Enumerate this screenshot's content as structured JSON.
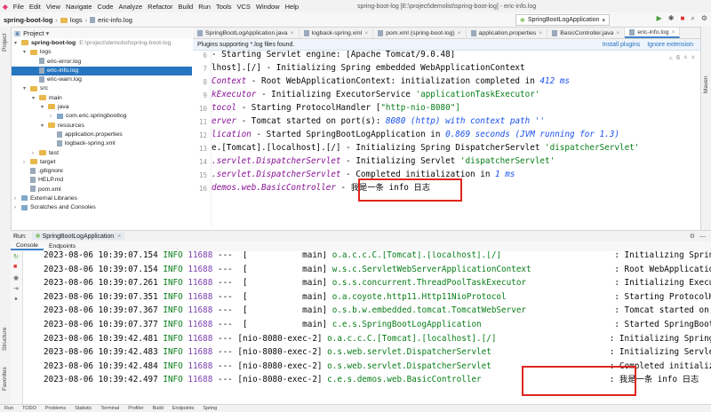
{
  "menu": {
    "items": [
      "File",
      "Edit",
      "View",
      "Navigate",
      "Code",
      "Analyze",
      "Refactor",
      "Build",
      "Run",
      "Tools",
      "VCS",
      "Window",
      "Help"
    ],
    "window_title": "spring-boot-log [E:\\project\\demolist\\spring-boot-log] - eric-info.log"
  },
  "breadcrumb": [
    "spring-boot-log",
    "logs",
    "eric-info.log"
  ],
  "run_config": "SpringBootLogApplication",
  "project": {
    "header": "Project",
    "tree": [
      {
        "label": "spring-boot-log",
        "suffix": "E:\\project\\demolist\\spring-boot-log",
        "indent": 0,
        "type": "folder",
        "open": true
      },
      {
        "label": "logs",
        "indent": 1,
        "type": "folder",
        "open": true
      },
      {
        "label": "eric-error.log",
        "indent": 2,
        "type": "file"
      },
      {
        "label": "eric-info.log",
        "indent": 2,
        "type": "file",
        "selected": true
      },
      {
        "label": "eric-warn.log",
        "indent": 2,
        "type": "file"
      },
      {
        "label": "src",
        "indent": 1,
        "type": "folder",
        "open": true
      },
      {
        "label": "main",
        "indent": 2,
        "type": "folder",
        "open": true
      },
      {
        "label": "java",
        "indent": 3,
        "type": "folder",
        "open": true
      },
      {
        "label": "com.eric.springbootlog",
        "indent": 4,
        "type": "pkg",
        "closed": true
      },
      {
        "label": "resources",
        "indent": 3,
        "type": "folder",
        "open": true
      },
      {
        "label": "application.properties",
        "indent": 4,
        "type": "file"
      },
      {
        "label": "logback-spring.xml",
        "indent": 4,
        "type": "file"
      },
      {
        "label": "test",
        "indent": 2,
        "type": "folder",
        "closed": true
      },
      {
        "label": "target",
        "indent": 1,
        "type": "folder",
        "closed": true
      },
      {
        "label": ".gitignore",
        "indent": 1,
        "type": "file"
      },
      {
        "label": "HELP.md",
        "indent": 1,
        "type": "file"
      },
      {
        "label": "pom.xml",
        "indent": 1,
        "type": "file"
      },
      {
        "label": "External Libraries",
        "indent": 0,
        "type": "pkg",
        "closed": true
      },
      {
        "label": "Scratches and Consoles",
        "indent": 0,
        "type": "pkg",
        "closed": true
      }
    ]
  },
  "tabs": [
    {
      "label": "SpringBootLogApplication.java"
    },
    {
      "label": "logback-spring.xml"
    },
    {
      "label": "pom.xml (spring-boot-log)"
    },
    {
      "label": "application.properties"
    },
    {
      "label": "BasicController.java"
    },
    {
      "label": "eric-info.log",
      "active": true
    }
  ],
  "notice": {
    "message": "Plugins supporting *.log files found.",
    "install": "Install plugins",
    "ignore": "Ignore extension"
  },
  "editor": {
    "gutter": [
      "6",
      "7",
      "8",
      "9",
      "10",
      "11",
      "12",
      "13",
      "14",
      "15",
      "16"
    ],
    "lines": [
      {
        "a": "- Starting Servlet engine: [Apache Tomcat/9.0.48]",
        "b": "",
        "c": ""
      },
      {
        "a": "lhost].[/] - Initializing Spring embedded WebApplicationContext",
        "b": "",
        "c": ""
      },
      {
        "a": "Context",
        "b": " - Root WebApplicationContext: initialization completed in ",
        "c": "412 ms"
      },
      {
        "a": "kExecutor",
        "b": " - Initializing ExecutorService ",
        "c": "'applicationTaskExecutor'"
      },
      {
        "a": "tocol",
        "b": " - Starting ProtocolHandler [",
        "c": "\"http-nio-8080\"]"
      },
      {
        "a": "erver",
        "b": " - Tomcat started on port(s): ",
        "c": "8080 (http) with context path ''"
      },
      {
        "a": "lication",
        "b": " - Started SpringBootLogApplication in ",
        "c": "0.869 seconds (JVM running for 1.3)"
      },
      {
        "a": "e.[Tomcat].[localhost].[/] - Initializing Spring DispatcherServlet ",
        "b": "",
        "c": "'dispatcherServlet'"
      },
      {
        "a": ".servlet.DispatcherServlet",
        "b": " - Initializing Servlet ",
        "c": "'dispatcherServlet'"
      },
      {
        "a": ".servlet.DispatcherServlet",
        "b": " - Completed initialization in ",
        "c": "1 ms"
      },
      {
        "a": "demos.web.BasicController",
        "b": " - 我是一条 info 日志",
        "c": ""
      }
    ]
  },
  "run_panel": {
    "label": "Run:",
    "config": "SpringBootLogApplication",
    "tabs": [
      "Console",
      "Endpoints"
    ]
  },
  "console": [
    {
      "t": "2023-08-06 10:39:07.154",
      "lv": "INFO",
      "pid": "11688",
      "th": "---  [           main]",
      "lg": "o.a.c.c.C.[Tomcat].[localhost].[/]",
      "msg": ": Initializing Spring embedded WebApplic"
    },
    {
      "t": "2023-08-06 10:39:07.154",
      "lv": "INFO",
      "pid": "11688",
      "th": "---  [           main]",
      "lg": "w.s.c.ServletWebServerApplicationContext",
      "msg": ": Root WebApplicationContext: initiali"
    },
    {
      "t": "2023-08-06 10:39:07.261",
      "lv": "INFO",
      "pid": "11688",
      "th": "---  [           main]",
      "lg": "o.s.s.concurrent.ThreadPoolTaskExecutor",
      "msg": ": Initializing ExecutorService 'applic"
    },
    {
      "t": "2023-08-06 10:39:07.351",
      "lv": "INFO",
      "pid": "11688",
      "th": "---  [           main]",
      "lg": "o.a.coyote.http11.Http11NioProtocol",
      "msg": ": Starting ProtocolHandler [\"http-nio"
    },
    {
      "t": "2023-08-06 10:39:07.367",
      "lv": "INFO",
      "pid": "11688",
      "th": "---  [           main]",
      "lg": "o.s.b.w.embedded.tomcat.TomcatWebServer",
      "msg": ": Tomcat started on port(s): 8080 (htt"
    },
    {
      "t": "2023-08-06 10:39:07.377",
      "lv": "INFO",
      "pid": "11688",
      "th": "---  [           main]",
      "lg": "c.e.s.SpringBootLogApplication",
      "msg": ": Started SpringBootLogApplication in"
    },
    {
      "t": "2023-08-06 10:39:42.481",
      "lv": "INFO",
      "pid": "11688",
      "th": "--- [nio-8080-exec-2]",
      "lg": "o.a.c.c.C.[Tomcat].[localhost].[/]",
      "msg": ": Initializing Spring DispatcherServle"
    },
    {
      "t": "2023-08-06 10:39:42.483",
      "lv": "INFO",
      "pid": "11688",
      "th": "--- [nio-8080-exec-2]",
      "lg": "o.s.web.servlet.DispatcherServlet",
      "msg": ": Initializing Servlet 'dispatcherServ"
    },
    {
      "t": "2023-08-06 10:39:42.484",
      "lv": "INFO",
      "pid": "11688",
      "th": "--- [nio-8080-exec-2]",
      "lg": "o.s.web.servlet.DispatcherServlet",
      "msg": ": Completed initialization in 1 ms"
    },
    {
      "t": "2023-08-06 10:39:42.497",
      "lv": "INFO",
      "pid": "11688",
      "th": "--- [nio-8080-exec-2]",
      "lg": "c.e.s.demos.web.BasicController",
      "msg": ": 我是一条 info 日志"
    }
  ],
  "side_labels": {
    "project": "Project",
    "structure": "Structure",
    "favorites": "Favorites",
    "maven": "Maven"
  },
  "status": [
    "Run",
    "TODO",
    "Problems",
    "Statistic",
    "Terminal",
    "Profiler",
    "Build",
    "Endpoints",
    "Spring"
  ]
}
